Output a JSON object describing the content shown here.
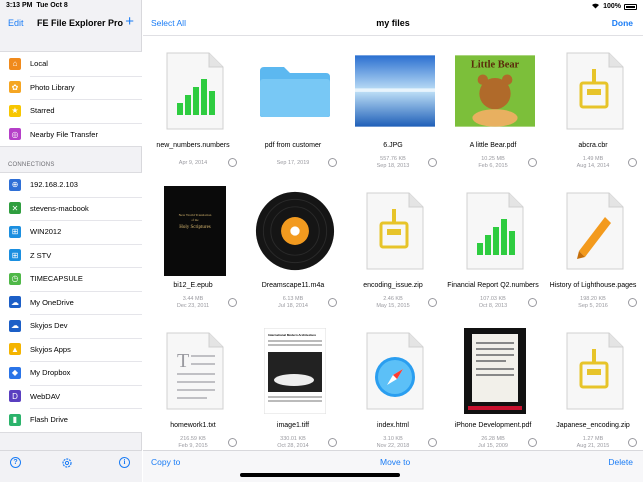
{
  "status": {
    "time": "3:13 PM",
    "date": "Tue Oct 8",
    "battery": "100%"
  },
  "sidebar": {
    "edit_label": "Edit",
    "title": "FE File Explorer Pro",
    "add_label": "+",
    "locations": [
      {
        "label": "Local",
        "icon": "house-icon",
        "color": "#f08a1c"
      },
      {
        "label": "Photo Library",
        "icon": "photos-icon",
        "color": "#f5a623"
      },
      {
        "label": "Starred",
        "icon": "star-icon",
        "color": "#f7c600"
      },
      {
        "label": "Nearby File Transfer",
        "icon": "airdrop-icon",
        "color": "#b53fc8"
      }
    ],
    "connections_header": "CONNECTIONS",
    "connections": [
      {
        "label": "192.168.2.103",
        "icon": "globe-icon",
        "color": "#2f6fd6"
      },
      {
        "label": "stevens-macbook",
        "icon": "xbox-icon",
        "color": "#2f9e3f"
      },
      {
        "label": "WIN2012",
        "icon": "windows-icon",
        "color": "#1b8fe0"
      },
      {
        "label": "Z STV",
        "icon": "windows-icon",
        "color": "#1b8fe0"
      },
      {
        "label": "TIMECAPSULE",
        "icon": "timecapsule-icon",
        "color": "#4fb848"
      },
      {
        "label": "My OneDrive",
        "icon": "cloud-icon",
        "color": "#1c5fc7"
      },
      {
        "label": "Skyjos Dev",
        "icon": "cloud-icon",
        "color": "#1c5fc7"
      },
      {
        "label": "Skyjos Apps",
        "icon": "drive-icon",
        "color": "#f4b400"
      },
      {
        "label": "My Dropbox",
        "icon": "dropbox-icon",
        "color": "#2a74e8"
      },
      {
        "label": "WebDAV",
        "icon": "webdav-icon",
        "color": "#5a3fc0"
      },
      {
        "label": "Flash Drive",
        "icon": "usb-icon",
        "color": "#2bb36b"
      }
    ]
  },
  "main": {
    "select_all_label": "Select All",
    "title": "my files",
    "done_label": "Done",
    "files": [
      {
        "name": "new_numbers.numbers",
        "meta1": "",
        "meta2": "Apr 9, 2014",
        "kind": "numbers"
      },
      {
        "name": "pdf from customer",
        "meta1": "",
        "meta2": "Sep 17, 2019",
        "kind": "folder"
      },
      {
        "name": "6.JPG",
        "meta1": "557.76 KB",
        "meta2": "Sep 18, 2013",
        "kind": "lake"
      },
      {
        "name": "A little Bear.pdf",
        "meta1": "10.25 MB",
        "meta2": "Feb 6, 2015",
        "kind": "bear",
        "cover_title": "Little Bear"
      },
      {
        "name": "abcra.cbr",
        "meta1": "1.49 MB",
        "meta2": "Aug 14, 2014",
        "kind": "zip"
      },
      {
        "name": "bi12_E.epub",
        "meta1": "3.44 MB",
        "meta2": "Dec 23, 2011",
        "kind": "book",
        "cover_line1": "New World Translation",
        "cover_line2": "of the",
        "cover_line3": "Holy Scriptures"
      },
      {
        "name": "Dreamscape11.m4a",
        "meta1": "6.13 MB",
        "meta2": "Jul 18, 2014",
        "kind": "vinyl"
      },
      {
        "name": "encoding_issue.zip",
        "meta1": "2.46 KB",
        "meta2": "May 15, 2015",
        "kind": "zip"
      },
      {
        "name": "Financial Report  Q2.numbers",
        "meta1": "107.03 KB",
        "meta2": "Oct 8, 2013",
        "kind": "numbers"
      },
      {
        "name": "History of Lighthouse.pages",
        "meta1": "198.20 KB",
        "meta2": "Sep 5, 2016",
        "kind": "pages"
      },
      {
        "name": "homework1.txt",
        "meta1": "216.59 KB",
        "meta2": "Feb 9, 2015",
        "kind": "text"
      },
      {
        "name": "image1.tiff",
        "meta1": "330.01 KB",
        "meta2": "Oct 28, 2014",
        "kind": "tiff",
        "doc_heading": "International Modern Architecture"
      },
      {
        "name": "index.html",
        "meta1": "3.10 KB",
        "meta2": "Nov 22, 2018",
        "kind": "safari"
      },
      {
        "name": "iPhone Development.pdf",
        "meta1": "26.28 MB",
        "meta2": "Jul 15, 2009",
        "kind": "iphonedoc"
      },
      {
        "name": "Japanese_encoding.zip",
        "meta1": "1.27 MB",
        "meta2": "Aug 21, 2015",
        "kind": "zip"
      }
    ]
  },
  "toolbar": {
    "copy_label": "Copy to",
    "move_label": "Move to",
    "delete_label": "Delete"
  },
  "colors": {
    "accent": "#1a7cf5",
    "numbers_green": "#2ecc40",
    "folder_blue": "#5cb8f0",
    "archive_gold": "#e7c42a"
  }
}
